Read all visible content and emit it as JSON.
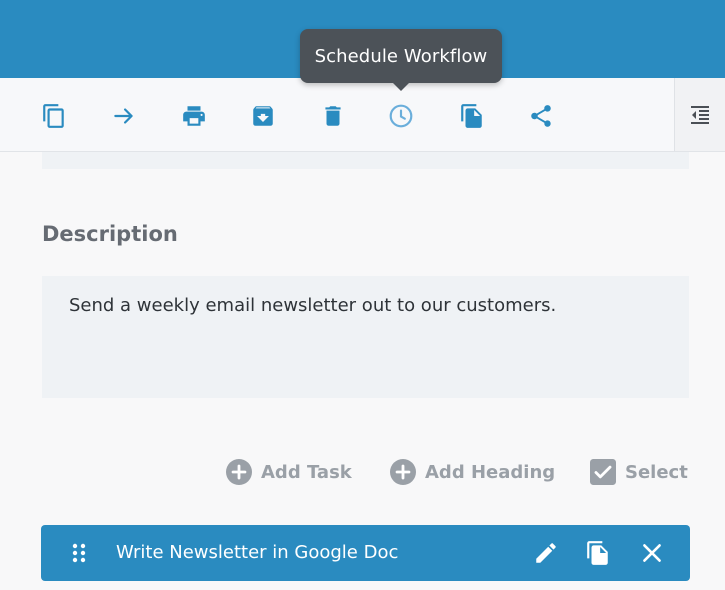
{
  "tooltip": {
    "text": "Schedule Workflow"
  },
  "toolbar": {
    "items": [
      {
        "icon": "copy-icon"
      },
      {
        "icon": "arrow-right-icon"
      },
      {
        "icon": "print-icon"
      },
      {
        "icon": "archive-icon"
      },
      {
        "icon": "trash-icon"
      },
      {
        "icon": "clock-icon"
      },
      {
        "icon": "file-copy-icon"
      },
      {
        "icon": "share-icon"
      }
    ],
    "collapse_icon": "collapse-panel-icon"
  },
  "description": {
    "heading": "Description",
    "text": "Send a weekly email newsletter out to our customers."
  },
  "actions": {
    "add_task": "Add Task",
    "add_heading": "Add Heading",
    "select": "Select"
  },
  "task": {
    "title": "Write Newsletter in Google Doc"
  },
  "colors": {
    "brand_blue": "#2a8bc0",
    "toolbar_icon": "#2a8bc0",
    "active_icon": "#6aaedb",
    "muted": "#9aa0a7",
    "tooltip_bg": "#4c5258"
  }
}
